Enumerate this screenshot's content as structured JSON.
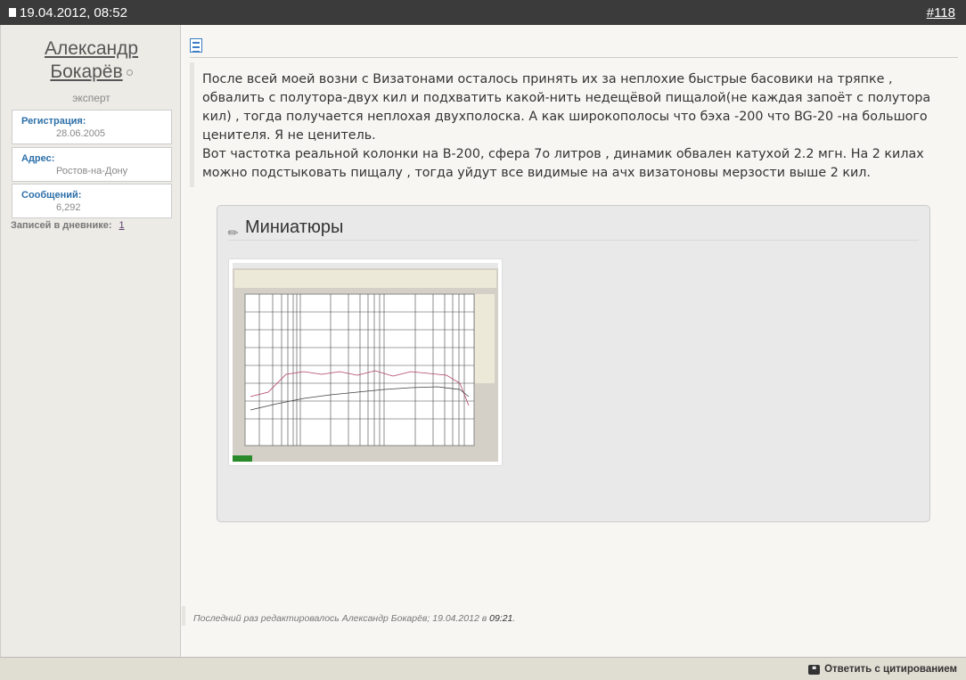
{
  "header": {
    "date": "19.04.2012, 08:52",
    "post_number": "#118"
  },
  "user": {
    "name_line1": "Александр",
    "name_line2": "Бокарёв",
    "rank": "эксперт",
    "fields": [
      {
        "label": "Регистрация:",
        "value": "28.06.2005"
      },
      {
        "label": "Адрес:",
        "value": "Ростов-на-Дону"
      },
      {
        "label": "Сообщений:",
        "value": "6,292"
      }
    ],
    "diary_label": "Записей в дневнике:",
    "diary_count": "1"
  },
  "post": {
    "paragraph1": "После всей моей возни с Визатонами осталось принять их за неплохие быстрые басовики на тряпке , обвалить с полутора-двух кил и подхватить какой-нить недещёвой пищалой(не каждая запоёт с полутора кил) , тогда получается неплохая двухполоска. А как широкополосы что бэха -200 что BG-20 -на большого ценителя. Я не ценитель.",
    "paragraph2": "Вот частотка реальной колонки на B-200, сфера 7о литров , динамик обвален катухой 2.2 мгн. На 2 килах можно подстыковать пищалу , тогда уйдут все видимые на ачх визатоновы мерзости выше 2 кил."
  },
  "attachments": {
    "title": "Миниатюры"
  },
  "edit": {
    "text": "Последний раз редактировалось Александр Бокарёв; 19.04.2012 в ",
    "time": "09:21",
    "dot": "."
  },
  "footer": {
    "reply_quote": "Ответить с цитированием"
  }
}
